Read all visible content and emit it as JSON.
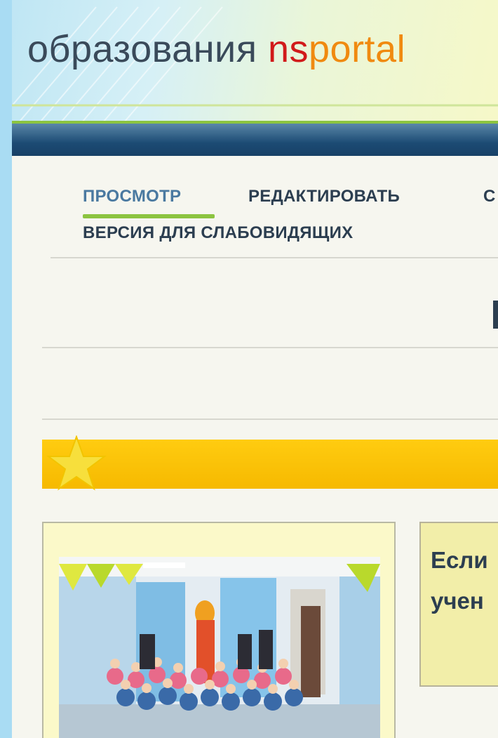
{
  "header": {
    "title_text": "образования ",
    "brand_ns": "ns",
    "brand_rest": "portal"
  },
  "tabs": [
    {
      "label": "ПРОСМОТР",
      "active": true
    },
    {
      "label": "РЕДАКТИРОВАТЬ",
      "active": false
    },
    {
      "label": "С",
      "active": false
    },
    {
      "label": "ВЕРСИЯ ДЛЯ СЛАБОВИДЯЩИХ",
      "active": false
    }
  ],
  "card_right": {
    "line1": "Если",
    "line2": "учен"
  },
  "colors": {
    "accent_green": "#8cc440",
    "nav_blue": "#1c4b74",
    "banner_yellow": "#ffcc10",
    "brand_red": "#d11a1a",
    "brand_orange": "#f08a10"
  },
  "icons": [
    "star-icon"
  ]
}
